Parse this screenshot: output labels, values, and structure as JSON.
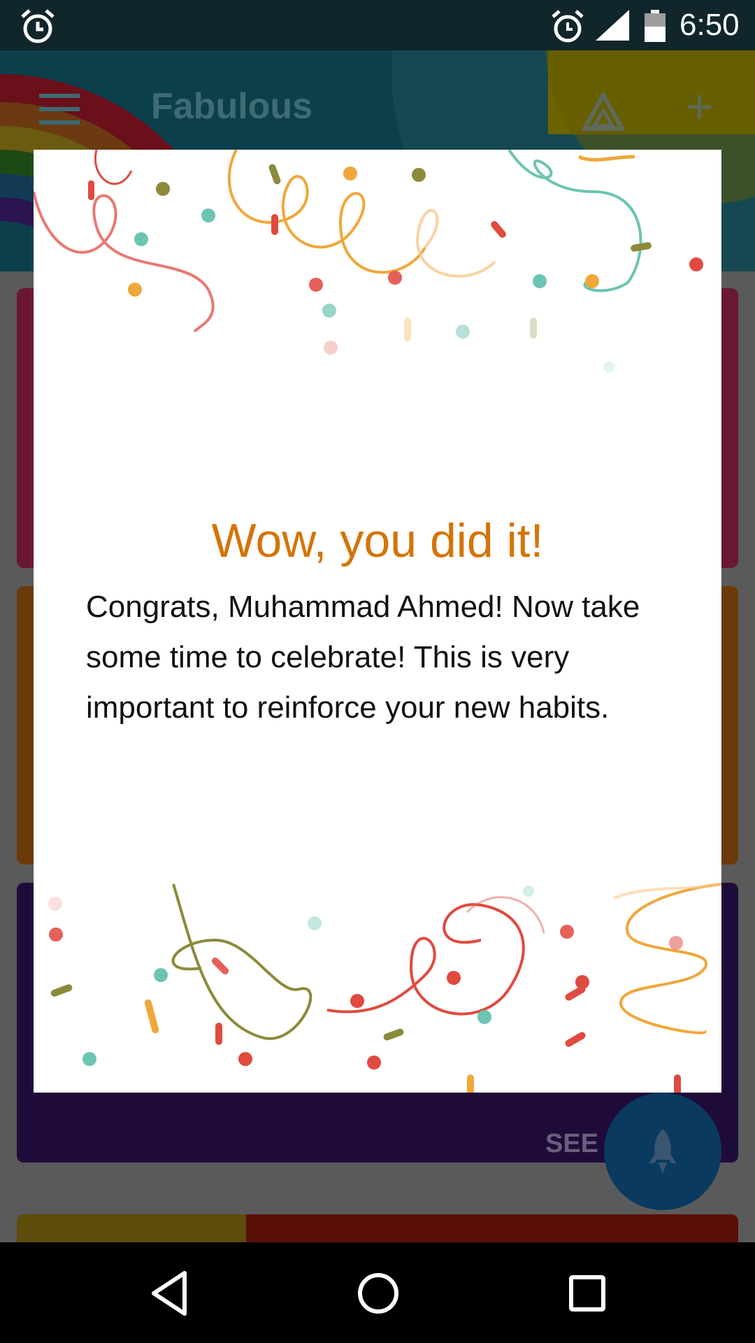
{
  "status_bar": {
    "time": "6:50"
  },
  "app": {
    "title": "Fabulous",
    "see_label": "SEE"
  },
  "dialog": {
    "title": "Wow, you did it!",
    "body": "Congrats, Muhammad Ahmed! Now take some time to celebrate! This is very important to reinforce your new habits."
  },
  "colors": {
    "title_orange": "#d47407",
    "dialog_bg": "#ffffff",
    "confetti": [
      "#e04a3f",
      "#f0a73a",
      "#6cc4b2",
      "#8c8a3a"
    ]
  },
  "icons": {
    "status": [
      "alarm-clock-icon",
      "alarm-icon",
      "signal-icon",
      "battery-icon"
    ],
    "app": [
      "menu-icon",
      "triangle-icon",
      "add-icon",
      "rocket-icon"
    ],
    "nav": [
      "back-icon",
      "home-icon",
      "recents-icon"
    ]
  }
}
